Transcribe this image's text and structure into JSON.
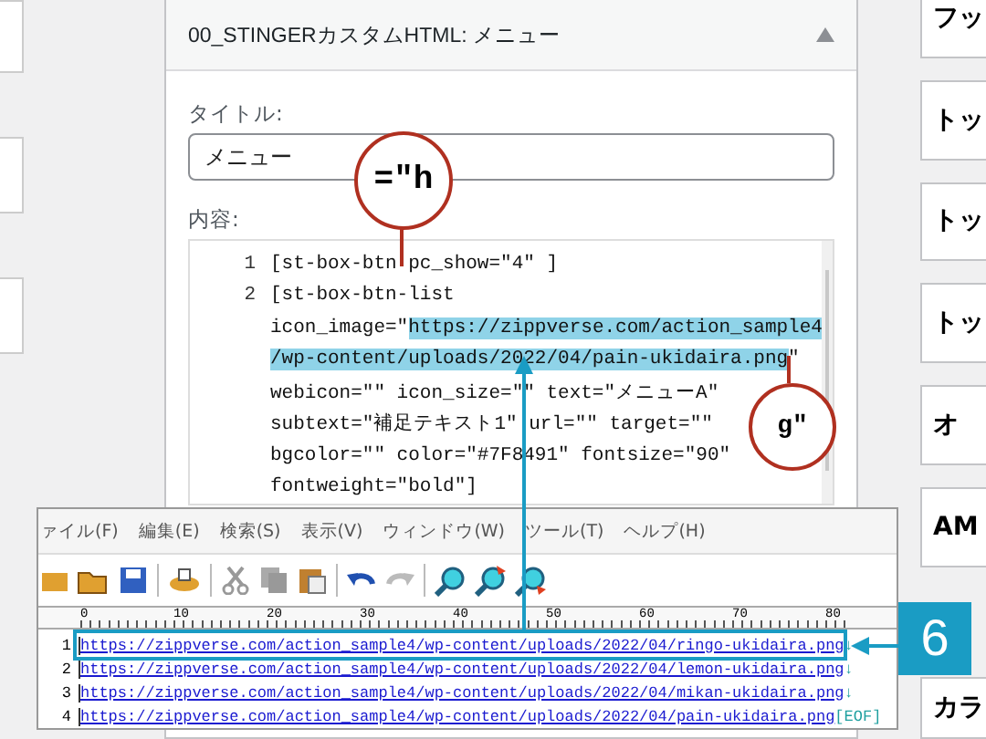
{
  "widget": {
    "title": "00_STINGERカスタムHTML: メニュー",
    "expanded": true,
    "title_label": "タイトル:",
    "title_value": "メニュー",
    "content_label": "内容:",
    "code_lines": [
      {
        "number": "1",
        "parts": [
          {
            "text": "[st-box-btn pc_show=\"4\" ]",
            "highlighted": false
          }
        ]
      },
      {
        "number": "2",
        "parts": [
          {
            "text": "[st-box-btn-list",
            "highlighted": false
          }
        ]
      },
      {
        "parts": [
          {
            "text": "icon_image=\"",
            "highlighted": false
          },
          {
            "text": "https://zippverse.com/action_sample4",
            "highlighted": true
          }
        ]
      },
      {
        "parts": [
          {
            "text": "/wp-content/uploads/2022/04/pain-ukidaira.png",
            "highlighted": true
          },
          {
            "text": "\"",
            "highlighted": false
          }
        ]
      },
      {
        "parts": [
          {
            "text": "webicon=\"\" icon_size=\"\" text=\"メニューA\"",
            "highlighted": false
          }
        ]
      },
      {
        "parts": [
          {
            "text": "subtext=\"補足テキスト1\" url=\"\" target=\"\"",
            "highlighted": false
          }
        ]
      },
      {
        "parts": [
          {
            "text": "bgcolor=\"\" color=\"#7F8491\" fontsize=\"90\"",
            "highlighted": false
          }
        ]
      },
      {
        "parts": [
          {
            "text": "fontweight=\"bold\"]",
            "highlighted": false
          }
        ]
      }
    ]
  },
  "side_cards": [
    "フッ",
    "トッ",
    "トッ",
    "トッ",
    "オ",
    "AM",
    "カラ"
  ],
  "magnifiers": [
    {
      "text": "=\"h"
    },
    {
      "text": "g\""
    }
  ],
  "editor": {
    "menu": [
      "ァイル(F)",
      "編集(E)",
      "検索(S)",
      "表示(V)",
      "ウィンドウ(W)",
      "ツール(T)",
      "ヘルプ(H)"
    ],
    "ruler": [
      "0",
      "10",
      "20",
      "30",
      "40",
      "50",
      "60",
      "70",
      "80"
    ],
    "lines": [
      {
        "number": "1",
        "text": "https://zippverse.com/action_sample4/wp-content/uploads/2022/04/ringo-ukidaira.png",
        "end": "↓"
      },
      {
        "number": "2",
        "text": "https://zippverse.com/action_sample4/wp-content/uploads/2022/04/lemon-ukidaira.png",
        "end": "↓"
      },
      {
        "number": "3",
        "text": "https://zippverse.com/action_sample4/wp-content/uploads/2022/04/mikan-ukidaira.png",
        "end": "↓"
      },
      {
        "number": "4",
        "text": "https://zippverse.com/action_sample4/wp-content/uploads/2022/04/pain-ukidaira.png",
        "end": "[EOF]"
      }
    ]
  },
  "callout": {
    "label": "6"
  }
}
